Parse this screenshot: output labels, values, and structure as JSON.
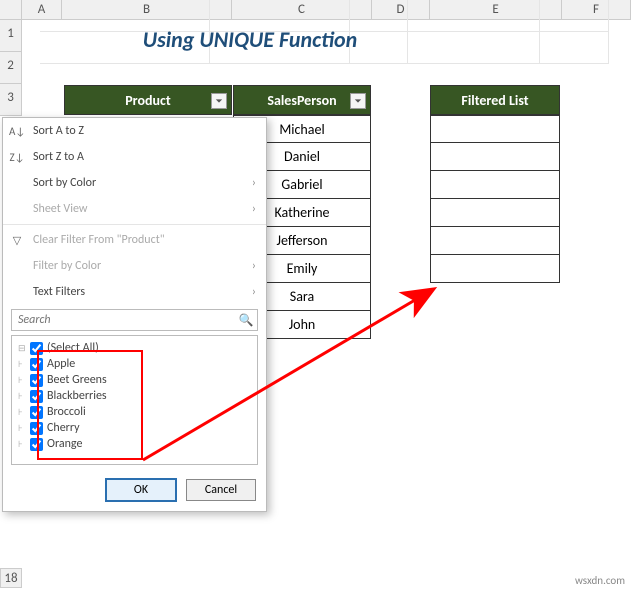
{
  "title": "Using UNIQUE Function",
  "columns": {
    "A": 22,
    "B": 131,
    "C": 140,
    "D": 61,
    "E": 132,
    "F": 118
  },
  "headers": {
    "product": "Product",
    "sales": "SalesPerson",
    "filtered": "Filtered List"
  },
  "sales_people": [
    "Michael",
    "Daniel",
    "Gabriel",
    "Katherine",
    "Jefferson",
    "Emily",
    "Sara",
    "John"
  ],
  "menu": {
    "sort_az": "Sort A to Z",
    "sort_za": "Sort Z to A",
    "sort_color": "Sort by Color",
    "sheet_view": "Sheet View",
    "clear_filter": "Clear Filter From \"Product\"",
    "filter_color": "Filter by Color",
    "text_filters": "Text Filters",
    "search_placeholder": "Search",
    "ok": "OK",
    "cancel": "Cancel"
  },
  "check_items": [
    "(Select All)",
    "Apple",
    "Beet Greens",
    "Blackberries",
    "Broccoli",
    "Cherry",
    "Orange"
  ],
  "col_letters": [
    "A",
    "B",
    "C",
    "D",
    "E",
    "F"
  ],
  "row_nums": [
    "1",
    "2",
    "3"
  ],
  "row18": "18",
  "watermark": "wsxdn.com",
  "chart_data": {
    "type": "table",
    "categories": [
      "Michael",
      "Daniel",
      "Gabriel",
      "Katherine",
      "Jefferson",
      "Emily",
      "Sara",
      "John"
    ],
    "filter_values": [
      "Apple",
      "Beet Greens",
      "Blackberries",
      "Broccoli",
      "Cherry",
      "Orange"
    ]
  }
}
